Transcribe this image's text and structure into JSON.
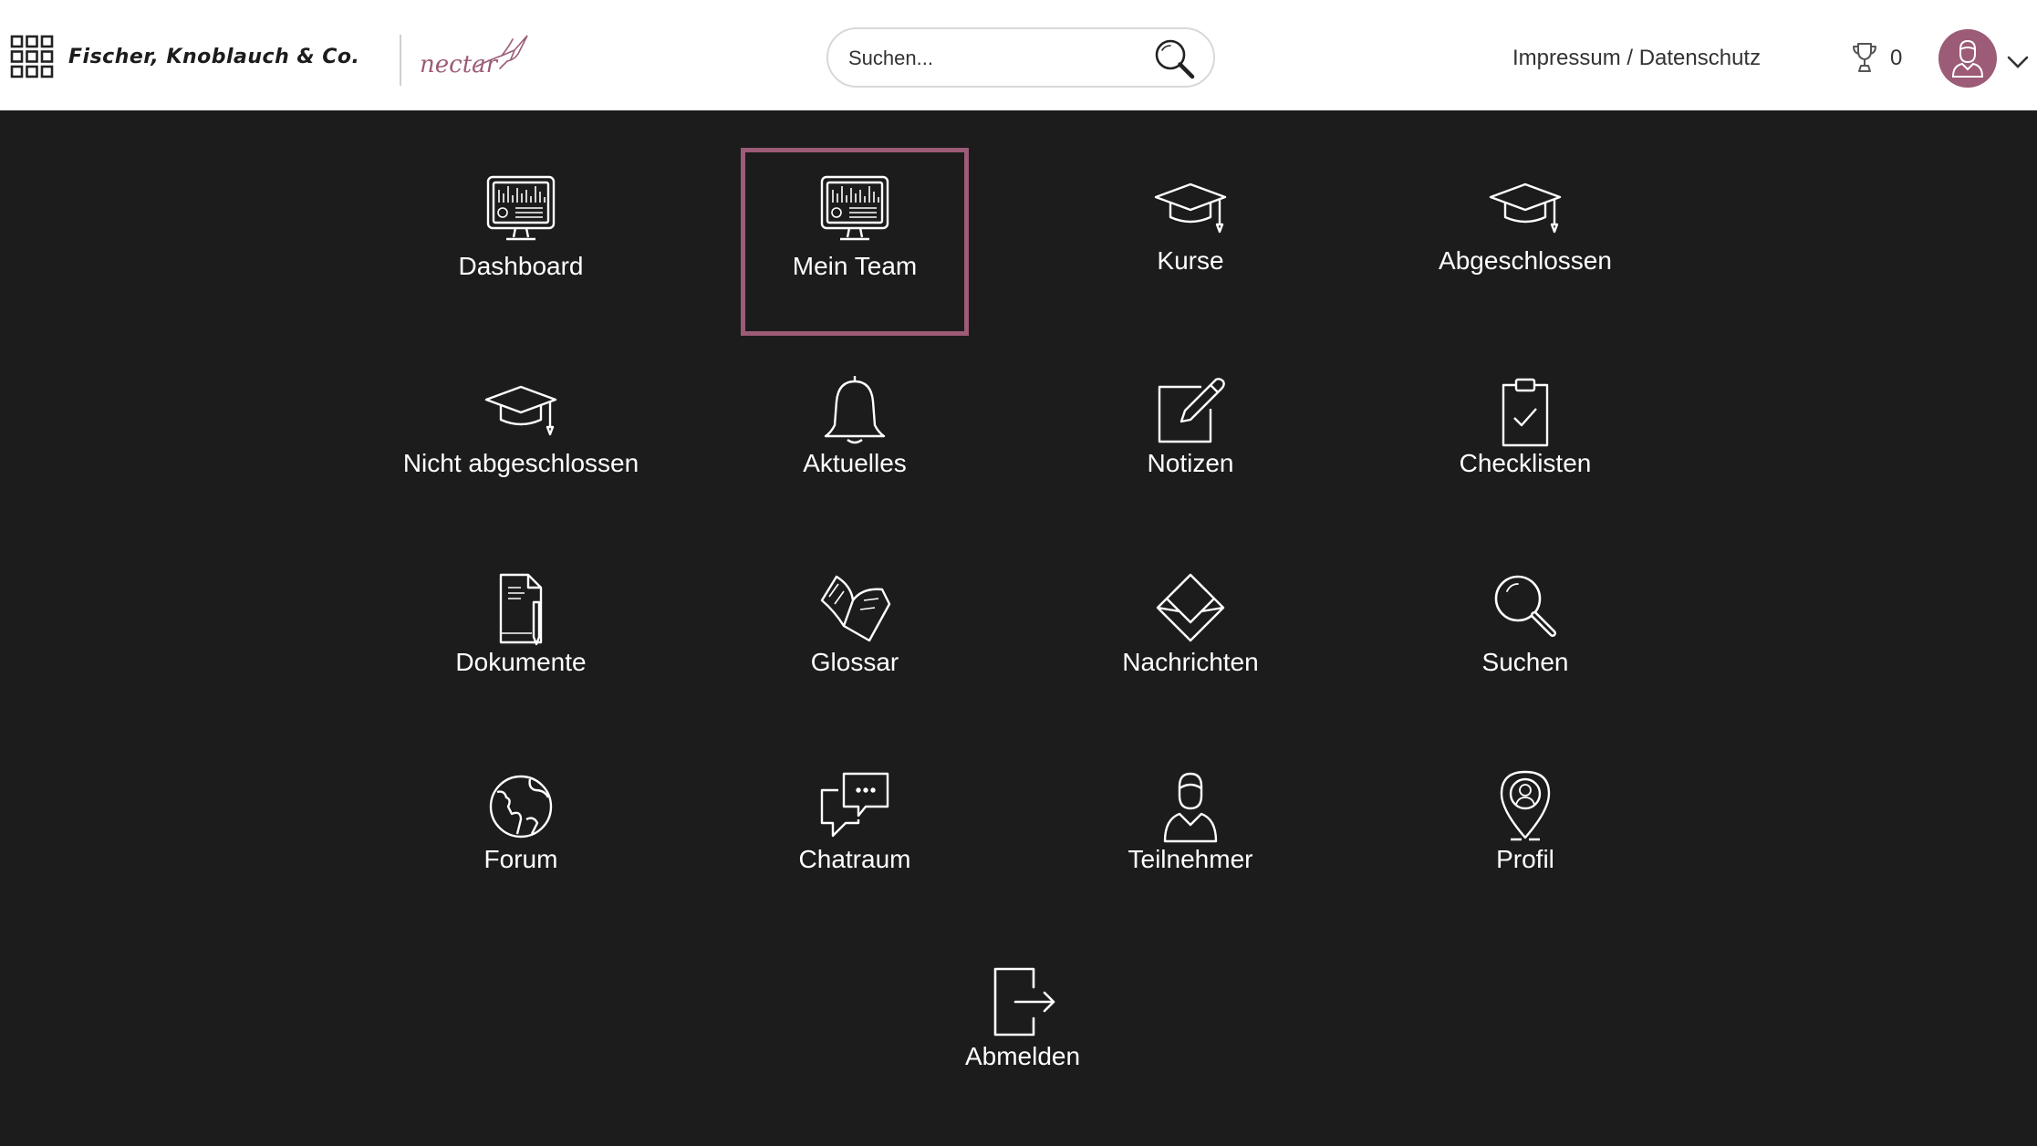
{
  "header": {
    "company_name": "Fischer, Knoblauch & Co.",
    "product_name": "nectar",
    "search_placeholder": "Suchen...",
    "impressum_link": "Impressum / Datenschutz",
    "trophy_count": "0",
    "icons": [
      "grid-icon",
      "bird-icon",
      "search-icon",
      "trophy-icon",
      "avatar-icon",
      "chevron-down-icon"
    ]
  },
  "colors": {
    "background": "#1c1c1c",
    "header_background": "#ffffff",
    "accent": "#9c5b76",
    "tile_text": "#ffffff"
  },
  "menu": {
    "active_item": "Mein Team",
    "items": [
      {
        "label": "Dashboard",
        "icon": "monitor-icon"
      },
      {
        "label": "Mein Team",
        "icon": "monitor-icon"
      },
      {
        "label": "Kurse",
        "icon": "graduation-cap-icon"
      },
      {
        "label": "Abgeschlossen",
        "icon": "graduation-cap-icon"
      },
      {
        "label": "Nicht abgeschlossen",
        "icon": "graduation-cap-icon"
      },
      {
        "label": "Aktuelles",
        "icon": "bell-icon"
      },
      {
        "label": "Notizen",
        "icon": "notes-pen-icon"
      },
      {
        "label": "Checklisten",
        "icon": "clipboard-check-icon"
      },
      {
        "label": "Dokumente",
        "icon": "document-icon"
      },
      {
        "label": "Glossar",
        "icon": "book-icon"
      },
      {
        "label": "Nachrichten",
        "icon": "envelope-icon"
      },
      {
        "label": "Suchen",
        "icon": "magnifier-icon"
      },
      {
        "label": "Forum",
        "icon": "globe-icon"
      },
      {
        "label": "Chatraum",
        "icon": "chat-bubbles-icon"
      },
      {
        "label": "Teilnehmer",
        "icon": "person-icon"
      },
      {
        "label": "Profil",
        "icon": "profile-pin-icon"
      },
      {
        "label": "Abmelden",
        "icon": "logout-icon"
      }
    ]
  }
}
